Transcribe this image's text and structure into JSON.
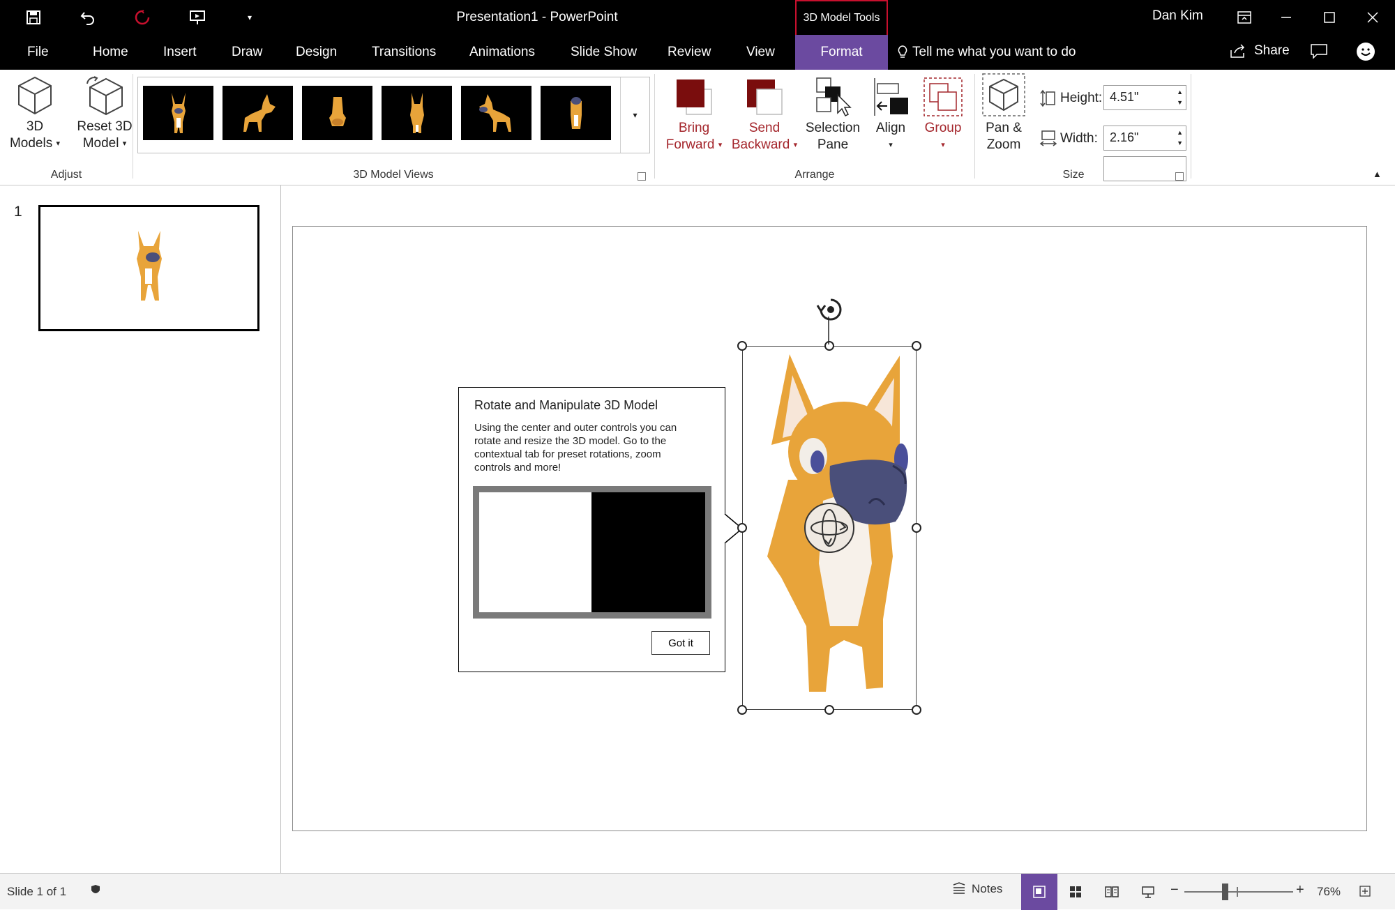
{
  "app": {
    "title": "Presentation1  -  PowerPoint",
    "contextual_group": "3D Model Tools",
    "user": "Dan Kim"
  },
  "tabs": [
    {
      "label": "File"
    },
    {
      "label": "Home"
    },
    {
      "label": "Insert"
    },
    {
      "label": "Draw"
    },
    {
      "label": "Design"
    },
    {
      "label": "Transitions"
    },
    {
      "label": "Animations"
    },
    {
      "label": "Slide Show"
    },
    {
      "label": "Review"
    },
    {
      "label": "View"
    },
    {
      "label": "Format"
    }
  ],
  "tell_me": "Tell me what you want to do",
  "share": "Share",
  "ribbon": {
    "adjust": {
      "label": "Adjust",
      "models_line1": "3D",
      "models_line2": "Models",
      "reset_line1": "Reset 3D",
      "reset_line2": "Model"
    },
    "views": {
      "label": "3D Model Views"
    },
    "arrange": {
      "label": "Arrange",
      "bring_line1": "Bring",
      "bring_line2": "Forward",
      "send_line1": "Send",
      "send_line2": "Backward",
      "sel_line1": "Selection",
      "sel_line2": "Pane",
      "align": "Align",
      "group": "Group"
    },
    "size": {
      "label": "Size",
      "pan_line1": "Pan &",
      "pan_line2": "Zoom",
      "height_label": "Height:",
      "height_value": "4.51\"",
      "width_label": "Width:",
      "width_value": "2.16\""
    }
  },
  "slides_pane": {
    "slide_number": "1"
  },
  "coachmark": {
    "title": "Rotate and Manipulate 3D Model",
    "body": "Using the center and outer controls you can rotate and resize the 3D model. Go to the contextual tab for preset rotations, zoom controls and more!",
    "button": "Got it"
  },
  "status": {
    "slide_info": "Slide 1 of 1",
    "notes": "Notes",
    "zoom": "76%"
  },
  "colors": {
    "accent": "#6b4aa0",
    "dark_red": "#7a0d0d",
    "dog_orange": "#e8a43a"
  }
}
